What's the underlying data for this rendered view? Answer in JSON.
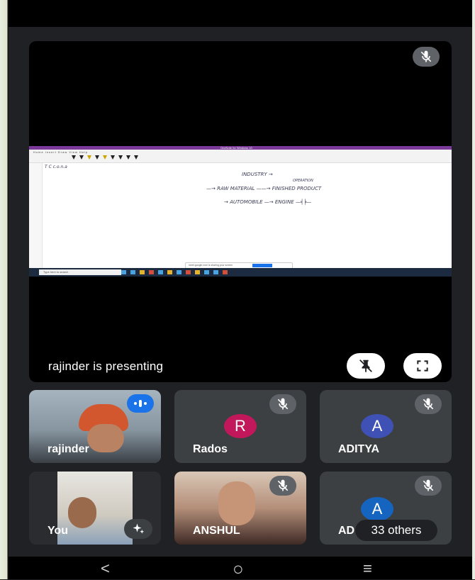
{
  "presenter": {
    "label": "rajinder is presenting",
    "shared_screen": {
      "window_title": "OneNote for Windows 10",
      "ribbon_tabs": "Home  Insert  Draw  View  Help",
      "canvas_labels": {
        "header_letters": "T      C      c.o.n.a",
        "industry": "INDUSTRY →",
        "operation": "OPERATION",
        "raw_material": "—→ RAW MATERIAL ——→ FINISHED PRODUCT",
        "automobile": "→ AUTOMOBILE —→   ENGINE  —╡╞—",
        "presenting_notice": "meet.google.com is sharing your screen",
        "stop_sharing": "Stop sharing",
        "hide": "Hide"
      },
      "taskbar_search": "Type here to search"
    }
  },
  "participants": [
    {
      "name": "rajinder",
      "type": "video",
      "status": "speaking"
    },
    {
      "name": "Rados",
      "initial": "R",
      "avatar_color": "#c2185b",
      "status": "muted"
    },
    {
      "name": "ADITYA",
      "initial": "A",
      "avatar_color": "#3f51b5",
      "status": "muted"
    },
    {
      "name": "You",
      "type": "video",
      "status": "self"
    },
    {
      "name": "ANSHUL",
      "type": "video",
      "status": "muted"
    },
    {
      "name": "AD",
      "initial": "A",
      "avatar_color": "#1565c0",
      "status": "muted",
      "others_label": "33 others"
    }
  ],
  "nav": {
    "back": "<",
    "home": "○",
    "recents": "≡"
  },
  "colors": {
    "background": "#202124",
    "tile": "#3c4043",
    "accent_blue": "#1a73e8"
  }
}
